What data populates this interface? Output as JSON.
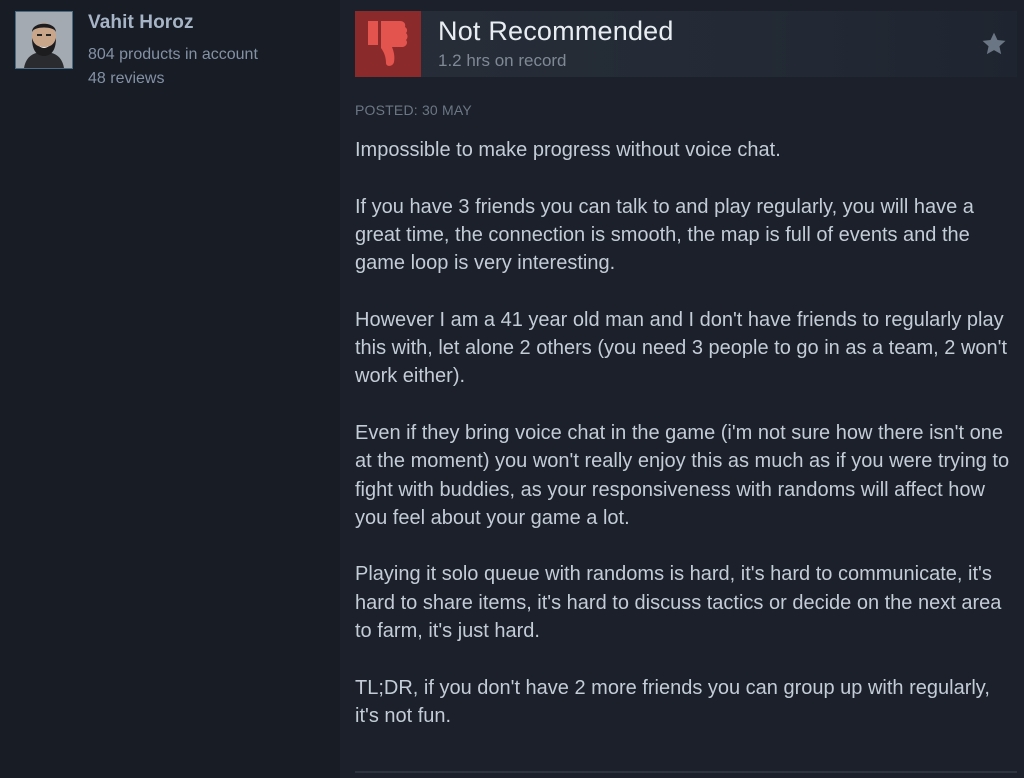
{
  "author": {
    "name": "Vahit Horoz",
    "products": "804 products in account",
    "reviews": "48 reviews"
  },
  "review": {
    "verdict": "Not Recommended",
    "hours": "1.2 hrs on record",
    "posted": "POSTED: 30 MAY",
    "paragraphs": [
      "Impossible to make progress without voice chat.",
      "If you have 3 friends you can talk to and play regularly, you will have a great time, the connection is smooth, the map is full of events and the game loop is very interesting.",
      "However I am a 41 year old man and I don't have friends to regularly play this with, let alone 2 others (you need 3 people to go in as a team, 2 won't work either).",
      "Even if they bring voice chat in the game (i'm not sure how there isn't one at the moment) you won't really enjoy this as much as if you were trying to fight with buddies, as your responsiveness with randoms will affect how you feel about your game a lot.",
      "Playing it solo queue with randoms is hard, it's hard to communicate, it's hard to share items, it's hard to discuss tactics or decide on the next area to farm, it's just hard.",
      "TL;DR, if you don't have 2 more friends you can group up with regularly, it's not fun."
    ]
  },
  "icons": {
    "verdict_icon": "thumbs-down-icon",
    "award_icon": "star-icon"
  },
  "colors": {
    "background": "#171c25",
    "review_panel": "#1b202a",
    "thumb_box": "#8a2a2b",
    "thumb_icon": "#e4544e",
    "author_name": "#a6b4c6",
    "body_text": "#c3ccd7"
  }
}
